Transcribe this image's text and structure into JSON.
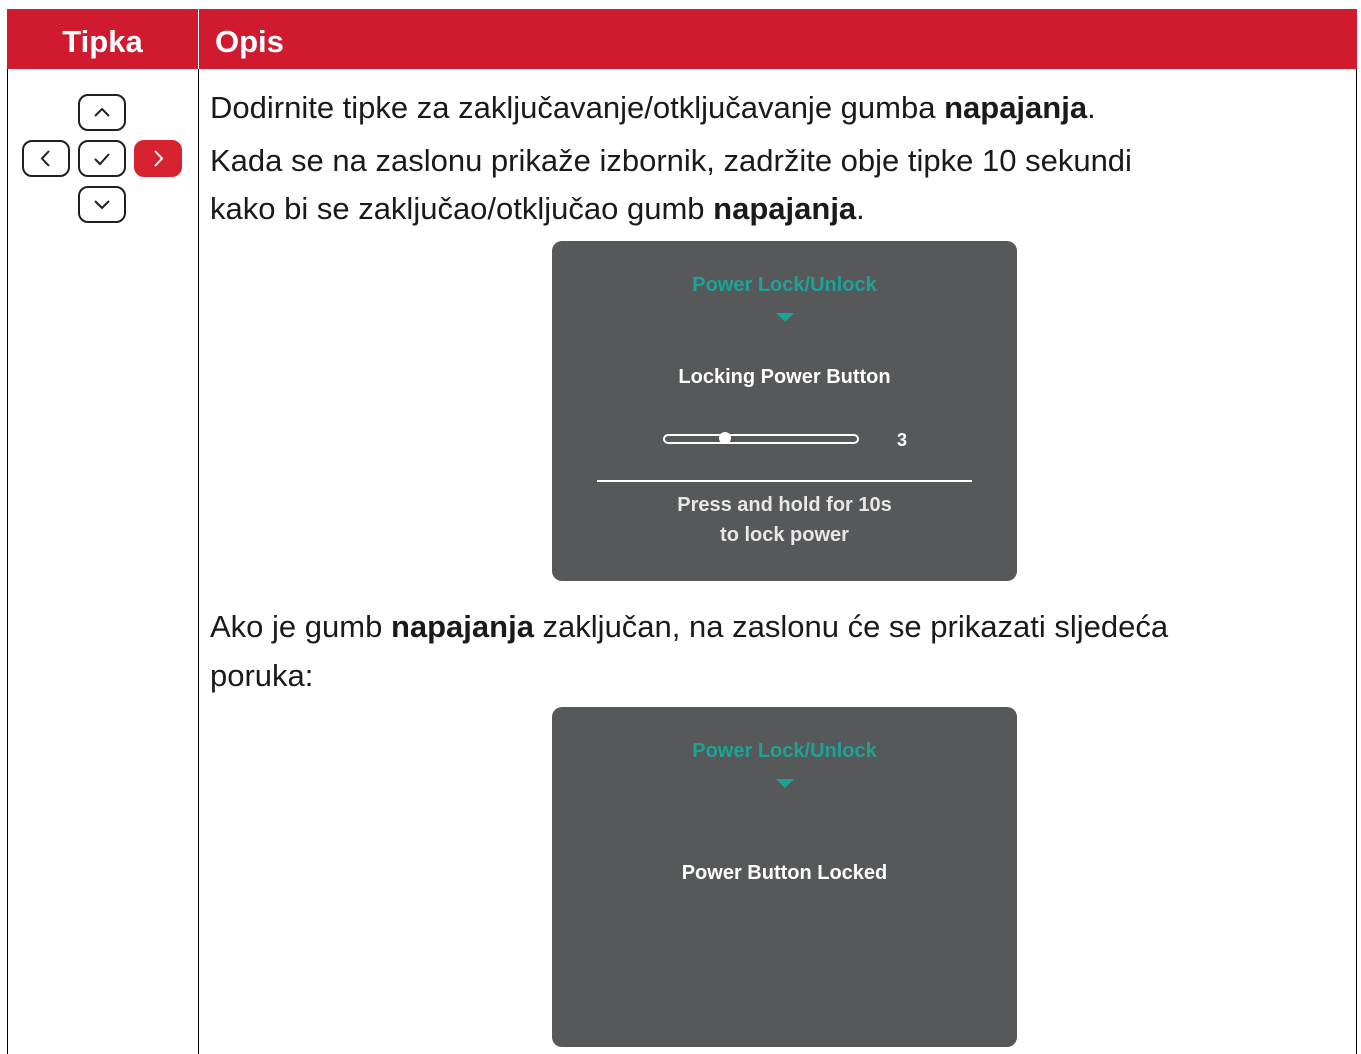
{
  "colors": {
    "header_bg": "#cf1a2f",
    "osd_bg": "#575859",
    "osd_accent": "#1aa495",
    "key_active": "#d7232f"
  },
  "table": {
    "header": {
      "key_col": "Tipka",
      "desc_col": "Opis"
    }
  },
  "keys": {
    "up": "chevron-up-icon",
    "left": "chevron-left-icon",
    "ok": "check-icon",
    "right": "chevron-right-icon",
    "down": "chevron-down-icon",
    "active_key": "right"
  },
  "description": {
    "p1_before": "Dodirnite tipke za zaključavanje/otključavanje gumba ",
    "p1_bold": "napajanja",
    "p1_after": ".",
    "p2_line1": "Kada se na zaslonu prikaže izbornik, zadržite obje tipke 10 sekundi",
    "p2_line2_before": "kako bi se zaključao/otključao gumb ",
    "p2_line2_bold": "napajanja",
    "p2_line2_after": ".",
    "p3_before": "Ako je gumb ",
    "p3_bold": "napajanja",
    "p3_after": " zaključan, na zaslonu će se prikazati sljedeća",
    "p3_line2": "poruka:"
  },
  "osd_locking": {
    "title": "Power Lock/Unlock",
    "message": "Locking Power Button",
    "countdown": "3",
    "progress_fraction": 0.3,
    "note_line1": "Press and hold for 10s",
    "note_line2": "to lock power"
  },
  "osd_locked": {
    "title": "Power Lock/Unlock",
    "message": "Power Button Locked"
  }
}
